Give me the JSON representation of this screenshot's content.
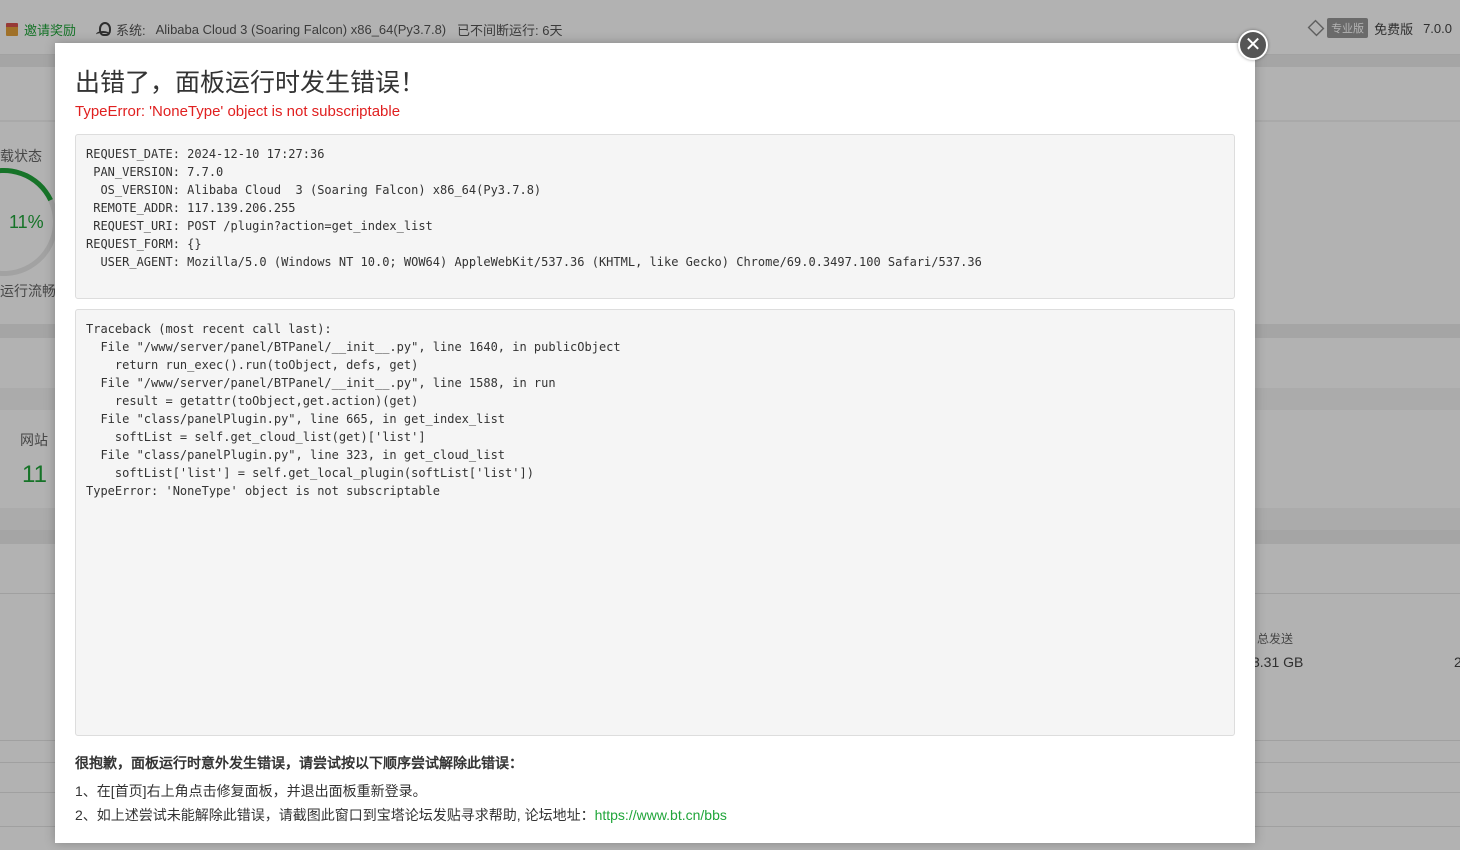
{
  "topbar": {
    "invite_label": "邀请奖励",
    "system_label": "系统:",
    "system_value": "Alibaba Cloud 3 (Soaring Falcon) x86_64(Py3.7.8)",
    "uptime": "已不间断运行: 6天",
    "pro_badge": "专业版",
    "free_label": "免费版",
    "version": "7.0.0"
  },
  "background": {
    "load_status_label": "载状态",
    "load_percent": "11%",
    "run_status": "运行流畅",
    "website_label": "网站",
    "website_count": "11",
    "total_sent_label": "总发送",
    "total_sent_value": "3.31 GB",
    "edge_char": "2"
  },
  "modal": {
    "title": "出错了，面板运行时发生错误！",
    "error_line": "TypeError: 'NoneType' object is not subscriptable",
    "info_text": "REQUEST_DATE: 2024-12-10 17:27:36\n PAN_VERSION: 7.7.0\n  OS_VERSION: Alibaba Cloud  3 (Soaring Falcon) x86_64(Py3.7.8)\n REMOTE_ADDR: 117.139.206.255\n REQUEST_URI: POST /plugin?action=get_index_list\nREQUEST_FORM: {}\n  USER_AGENT: Mozilla/5.0 (Windows NT 10.0; WOW64) AppleWebKit/537.36 (KHTML, like Gecko) Chrome/69.0.3497.100 Safari/537.36",
    "traceback_text": "Traceback (most recent call last):\n  File \"/www/server/panel/BTPanel/__init__.py\", line 1640, in publicObject\n    return run_exec().run(toObject, defs, get)\n  File \"/www/server/panel/BTPanel/__init__.py\", line 1588, in run\n    result = getattr(toObject,get.action)(get)\n  File \"class/panelPlugin.py\", line 665, in get_index_list\n    softList = self.get_cloud_list(get)['list']\n  File \"class/panelPlugin.py\", line 323, in get_cloud_list\n    softList['list'] = self.get_local_plugin(softList['list'])\nTypeError: 'NoneType' object is not subscriptable",
    "help_title": "很抱歉，面板运行时意外发生错误，请尝试按以下顺序尝试解除此错误：",
    "help_step1": "1、在[首页]右上角点击修复面板，并退出面板重新登录。",
    "help_step2_prefix": "2、如上述尝试未能解除此错误，请截图此窗口到宝塔论坛发贴寻求帮助, 论坛地址：",
    "help_link": "https://www.bt.cn/bbs",
    "close_symbol": "✕"
  }
}
